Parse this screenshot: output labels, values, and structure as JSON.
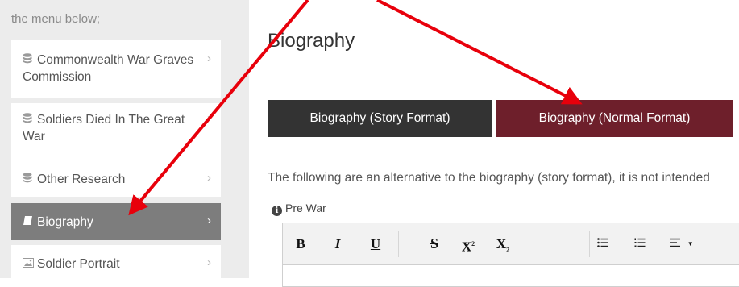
{
  "sidebar": {
    "intro": "the menu below;",
    "items": [
      {
        "icon": "database-icon",
        "label": "Commonwealth War Graves Commission",
        "chevron": "›"
      },
      {
        "icon": "database-icon",
        "label": "Soldiers Died In The Great War",
        "chevron": "›"
      },
      {
        "icon": "database-icon",
        "label": "Other Research",
        "chevron": "›"
      },
      {
        "icon": "book-icon",
        "label": "Biography",
        "chevron": "›",
        "active": true
      },
      {
        "icon": "image-icon",
        "label": "Soldier Portrait",
        "chevron": "›"
      }
    ]
  },
  "main": {
    "title": "Biography",
    "tabs": [
      {
        "label": "Biography (Story Format)"
      },
      {
        "label": "Biography (Normal Format)",
        "active": true
      }
    ],
    "description": "The following are an alternative to the biography (story format), it is not intended",
    "field_label": "Pre War",
    "toolbar": {
      "bold": "B",
      "italic": "I",
      "underline": "U",
      "strike": "S",
      "superscript": "X",
      "subscript": "X",
      "bullet_list_icon": "bullet-list-icon",
      "numbered_list_icon": "numbered-list-icon",
      "align_icon": "align-icon"
    }
  },
  "colors": {
    "sidebar_bg": "#ececec",
    "active_item": "#7d7d7d",
    "tab_story": "#333333",
    "tab_normal": "#6e1f2b",
    "annotation_arrow": "#e8000b"
  }
}
